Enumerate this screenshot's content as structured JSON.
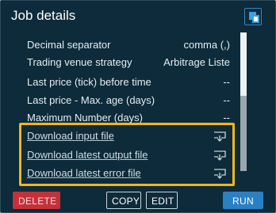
{
  "panel": {
    "title": "Job details"
  },
  "settings": [
    {
      "label": "Decimal separator",
      "value": "comma (,)"
    },
    {
      "label": "Trading venue strategy",
      "value": "Arbitrage Liste"
    },
    {
      "label": "Last price (tick) before time",
      "value": "--"
    },
    {
      "label": "Last price - Max. age (days)",
      "value": "--"
    },
    {
      "label": "Maximum Number (days)",
      "value": "--"
    }
  ],
  "downloads": [
    {
      "label": "Download input file",
      "icon": "download-icon"
    },
    {
      "label": "Download latest output file",
      "icon": "download-icon"
    },
    {
      "label": "Download latest error file",
      "icon": "download-icon"
    }
  ],
  "actions": {
    "delete_label": "DELETE",
    "copy_label": "COPY",
    "edit_label": "EDIT",
    "run_label": "RUN"
  },
  "scrollbar": {
    "position_fraction": 0.46
  },
  "colors": {
    "panel_bg": "#0d2b3a",
    "highlight": "#f2b61d",
    "delete": "#c4313b",
    "run": "#2a80c2"
  }
}
